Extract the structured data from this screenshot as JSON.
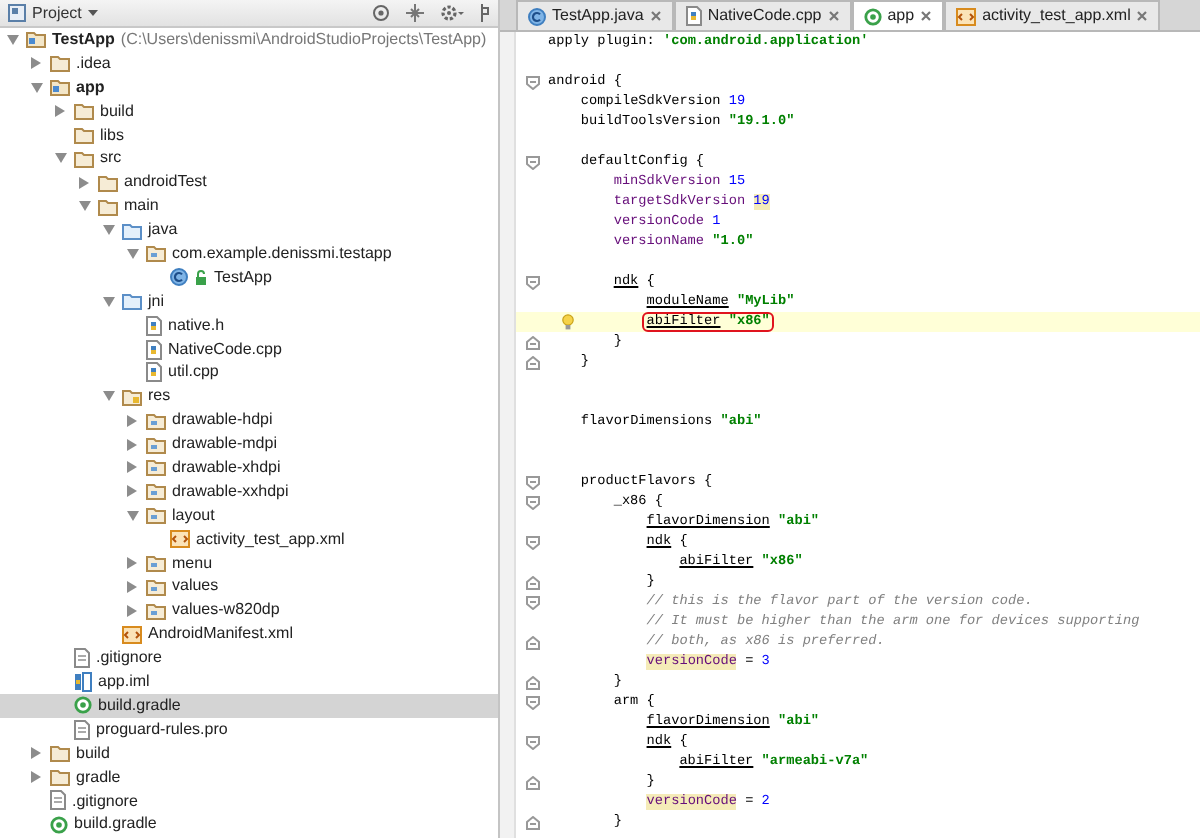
{
  "project_panel": {
    "title": "Project",
    "tree": [
      {
        "label": "TestApp",
        "path": "(C:\\Users\\denissmi\\AndroidStudioProjects\\TestApp)",
        "kind": "module",
        "expanded": true,
        "selected": false,
        "children": [
          {
            "label": ".idea",
            "kind": "folder",
            "expanded": false,
            "selected": false
          },
          {
            "label": "app",
            "kind": "module",
            "expanded": true,
            "selected": false,
            "children": [
              {
                "label": "build",
                "kind": "folder",
                "expanded": false,
                "selected": false
              },
              {
                "label": "libs",
                "kind": "folder",
                "selected": false
              },
              {
                "label": "src",
                "kind": "folder",
                "expanded": true,
                "selected": false,
                "children": [
                  {
                    "label": "androidTest",
                    "kind": "folder",
                    "expanded": false,
                    "selected": false
                  },
                  {
                    "label": "main",
                    "kind": "folder",
                    "expanded": true,
                    "selected": false,
                    "children": [
                      {
                        "label": "java",
                        "kind": "source-folder",
                        "expanded": true,
                        "selected": false,
                        "children": [
                          {
                            "label": "com.example.denissmi.testapp",
                            "kind": "package",
                            "expanded": true,
                            "selected": false,
                            "children": [
                              {
                                "label": "TestApp",
                                "kind": "class",
                                "selected": false
                              }
                            ]
                          }
                        ]
                      },
                      {
                        "label": "jni",
                        "kind": "source-folder",
                        "expanded": true,
                        "selected": false,
                        "children": [
                          {
                            "label": "native.h",
                            "kind": "source-file",
                            "selected": false
                          },
                          {
                            "label": "NativeCode.cpp",
                            "kind": "source-file",
                            "selected": false
                          },
                          {
                            "label": "util.cpp",
                            "kind": "source-file",
                            "selected": false
                          }
                        ]
                      },
                      {
                        "label": "res",
                        "kind": "res-folder",
                        "expanded": true,
                        "selected": false,
                        "children": [
                          {
                            "label": "drawable-hdpi",
                            "kind": "res-dir",
                            "expanded": false,
                            "selected": false
                          },
                          {
                            "label": "drawable-mdpi",
                            "kind": "res-dir",
                            "expanded": false,
                            "selected": false
                          },
                          {
                            "label": "drawable-xhdpi",
                            "kind": "res-dir",
                            "expanded": false,
                            "selected": false
                          },
                          {
                            "label": "drawable-xxhdpi",
                            "kind": "res-dir",
                            "expanded": false,
                            "selected": false
                          },
                          {
                            "label": "layout",
                            "kind": "res-dir",
                            "expanded": true,
                            "selected": false,
                            "children": [
                              {
                                "label": "activity_test_app.xml",
                                "kind": "xml",
                                "selected": false
                              }
                            ]
                          },
                          {
                            "label": "menu",
                            "kind": "res-dir",
                            "expanded": false,
                            "selected": false
                          },
                          {
                            "label": "values",
                            "kind": "res-dir",
                            "expanded": false,
                            "selected": false
                          },
                          {
                            "label": "values-w820dp",
                            "kind": "res-dir",
                            "expanded": false,
                            "selected": false
                          }
                        ]
                      },
                      {
                        "label": "AndroidManifest.xml",
                        "kind": "xml",
                        "selected": false
                      }
                    ]
                  }
                ]
              },
              {
                "label": ".gitignore",
                "kind": "text",
                "selected": false
              },
              {
                "label": "app.iml",
                "kind": "iml",
                "selected": false
              },
              {
                "label": "build.gradle",
                "kind": "gradle",
                "selected": true
              },
              {
                "label": "proguard-rules.pro",
                "kind": "text",
                "selected": false
              }
            ]
          },
          {
            "label": "build",
            "kind": "folder",
            "expanded": false,
            "selected": false
          },
          {
            "label": "gradle",
            "kind": "folder",
            "expanded": false,
            "selected": false
          },
          {
            "label": ".gitignore",
            "kind": "text",
            "selected": false
          },
          {
            "label": "build.gradle",
            "kind": "gradle",
            "selected": false
          }
        ]
      }
    ]
  },
  "editor": {
    "tabs": [
      {
        "label": "TestApp.java",
        "kind": "class",
        "selected": false
      },
      {
        "label": "NativeCode.cpp",
        "kind": "source-file",
        "selected": false
      },
      {
        "label": "app",
        "kind": "gradle",
        "selected": true
      },
      {
        "label": "activity_test_app.xml",
        "kind": "xml",
        "selected": false
      }
    ],
    "lines": [
      {
        "kind": "plain",
        "current": false,
        "tokens": [
          {
            "kind": "plain",
            "text": "apply plugin: "
          },
          {
            "kind": "string",
            "text": "'com.android.application'"
          }
        ]
      },
      {
        "kind": "plain",
        "current": false
      },
      {
        "kind": "fold-start",
        "current": false,
        "tokens": [
          {
            "kind": "plain",
            "text": "android {"
          }
        ],
        "children": [
          {
            "kind": "plain",
            "current": false,
            "tokens": [
              {
                "kind": "plain",
                "text": "compileSdkVersion "
              },
              {
                "kind": "number",
                "text": "19"
              }
            ]
          },
          {
            "kind": "plain",
            "current": false,
            "tokens": [
              {
                "kind": "plain",
                "text": "buildToolsVersion "
              },
              {
                "kind": "string",
                "text": "\"19.1.0\""
              }
            ]
          },
          {
            "kind": "plain",
            "current": false
          },
          {
            "kind": "fold-start",
            "current": false,
            "tokens": [
              {
                "kind": "plain",
                "text": "defaultConfig {"
              }
            ],
            "children": [
              {
                "kind": "plain",
                "current": false,
                "tokens": [
                  {
                    "kind": "prop",
                    "text": "minSdkVersion "
                  },
                  {
                    "kind": "number",
                    "text": "15"
                  }
                ]
              },
              {
                "kind": "plain",
                "current": false,
                "tokens": [
                  {
                    "kind": "prop",
                    "text": "targetSdkVersion "
                  },
                  {
                    "kind": "number-flagged",
                    "text": "19"
                  }
                ]
              },
              {
                "kind": "plain",
                "current": false,
                "tokens": [
                  {
                    "kind": "prop",
                    "text": "versionCode "
                  },
                  {
                    "kind": "number",
                    "text": "1"
                  }
                ]
              },
              {
                "kind": "plain",
                "current": false,
                "tokens": [
                  {
                    "kind": "prop",
                    "text": "versionName "
                  },
                  {
                    "kind": "string",
                    "text": "\"1.0\""
                  }
                ]
              },
              {
                "kind": "plain",
                "current": false
              },
              {
                "kind": "fold-start",
                "current": false,
                "tokens": [
                  {
                    "kind": "call",
                    "text": "ndk"
                  },
                  {
                    "kind": "plain",
                    "text": " {"
                  }
                ],
                "children": [
                  {
                    "kind": "plain",
                    "current": false,
                    "tokens": [
                      {
                        "kind": "call",
                        "text": "moduleName"
                      },
                      {
                        "kind": "string",
                        "text": " \"MyLib\""
                      }
                    ]
                  },
                  {
                    "kind": "plain",
                    "current": true,
                    "tokens": [
                      {
                        "kind": "box",
                        "children": [
                          {
                            "kind": "call",
                            "text": "abiFilter"
                          },
                          {
                            "kind": "string",
                            "text": " \"x86\""
                          }
                        ]
                      }
                    ]
                  }
                ]
              },
              {
                "kind": "fold-end",
                "current": false,
                "tokens": [
                  {
                    "kind": "plain",
                    "text": "}"
                  }
                ]
              }
            ]
          },
          {
            "kind": "fold-end",
            "current": false,
            "tokens": [
              {
                "kind": "plain",
                "text": "}"
              }
            ]
          },
          {
            "kind": "plain",
            "current": false
          },
          {
            "kind": "plain",
            "current": false
          },
          {
            "kind": "plain",
            "current": false,
            "tokens": [
              {
                "kind": "plain",
                "text": "flavorDimensions "
              },
              {
                "kind": "string",
                "text": "\"abi\""
              }
            ]
          },
          {
            "kind": "plain",
            "current": false
          },
          {
            "kind": "plain",
            "current": false
          },
          {
            "kind": "fold-start",
            "current": false,
            "tokens": [
              {
                "kind": "plain",
                "text": "productFlavors {"
              }
            ],
            "children": [
              {
                "kind": "fold-start",
                "current": false,
                "tokens": [
                  {
                    "kind": "plain",
                    "text": "_x86 {"
                  }
                ],
                "children": [
                  {
                    "kind": "plain",
                    "current": false,
                    "tokens": [
                      {
                        "kind": "call",
                        "text": "flavorDimension"
                      },
                      {
                        "kind": "string",
                        "text": " \"abi\""
                      }
                    ]
                  },
                  {
                    "kind": "fold-start",
                    "current": false,
                    "tokens": [
                      {
                        "kind": "call",
                        "text": "ndk"
                      },
                      {
                        "kind": "plain",
                        "text": " {"
                      }
                    ],
                    "children": [
                      {
                        "kind": "plain",
                        "current": false,
                        "tokens": [
                          {
                            "kind": "call",
                            "text": "abiFilter"
                          },
                          {
                            "kind": "string",
                            "text": " \"x86\""
                          }
                        ]
                      }
                    ]
                  },
                  {
                    "kind": "fold-end",
                    "current": false,
                    "tokens": [
                      {
                        "kind": "plain",
                        "text": "}"
                      }
                    ]
                  },
                  {
                    "kind": "fold-start",
                    "current": false,
                    "tokens": [
                      {
                        "kind": "comment",
                        "text": "// this is the flavor part of the version code."
                      }
                    ]
                  },
                  {
                    "kind": "plain",
                    "current": false,
                    "tokens": [
                      {
                        "kind": "comment",
                        "text": "// It must be higher than the arm one for devices supporting"
                      }
                    ]
                  },
                  {
                    "kind": "fold-end",
                    "current": false,
                    "tokens": [
                      {
                        "kind": "comment",
                        "text": "// both, as x86 is preferred."
                      }
                    ]
                  },
                  {
                    "kind": "plain",
                    "current": false,
                    "tokens": [
                      {
                        "kind": "prop-flagged",
                        "text": "versionCode"
                      },
                      {
                        "kind": "plain",
                        "text": " = "
                      },
                      {
                        "kind": "number",
                        "text": "3"
                      }
                    ]
                  }
                ]
              },
              {
                "kind": "fold-end",
                "current": false,
                "tokens": [
                  {
                    "kind": "plain",
                    "text": "}"
                  }
                ]
              },
              {
                "kind": "fold-start",
                "current": false,
                "tokens": [
                  {
                    "kind": "plain",
                    "text": "arm {"
                  }
                ],
                "children": [
                  {
                    "kind": "plain",
                    "current": false,
                    "tokens": [
                      {
                        "kind": "call",
                        "text": "flavorDimension"
                      },
                      {
                        "kind": "string",
                        "text": " \"abi\""
                      }
                    ]
                  },
                  {
                    "kind": "fold-start",
                    "current": false,
                    "tokens": [
                      {
                        "kind": "call",
                        "text": "ndk"
                      },
                      {
                        "kind": "plain",
                        "text": " {"
                      }
                    ],
                    "children": [
                      {
                        "kind": "plain",
                        "current": false,
                        "tokens": [
                          {
                            "kind": "call",
                            "text": "abiFilter"
                          },
                          {
                            "kind": "string",
                            "text": " \"armeabi-v7a\""
                          }
                        ]
                      }
                    ]
                  },
                  {
                    "kind": "fold-end",
                    "current": false,
                    "tokens": [
                      {
                        "kind": "plain",
                        "text": "}"
                      }
                    ]
                  },
                  {
                    "kind": "plain",
                    "current": false,
                    "tokens": [
                      {
                        "kind": "prop-flagged",
                        "text": "versionCode"
                      },
                      {
                        "kind": "plain",
                        "text": " = "
                      },
                      {
                        "kind": "number",
                        "text": "2"
                      }
                    ]
                  }
                ]
              },
              {
                "kind": "fold-end",
                "current": false,
                "tokens": [
                  {
                    "kind": "plain",
                    "text": "}"
                  }
                ]
              }
            ]
          }
        ]
      }
    ]
  }
}
